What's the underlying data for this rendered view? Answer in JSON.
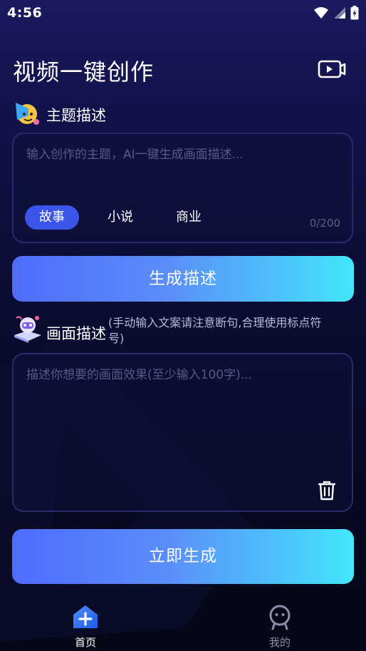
{
  "status": {
    "time": "4:56"
  },
  "header": {
    "title": "视频一键创作"
  },
  "theme_section": {
    "label": "主题描述",
    "placeholder": "输入创作的主题，AI一键生成画面描述...",
    "chips": [
      "故事",
      "小说",
      "商业"
    ],
    "active_chip": 0,
    "counter": "0/200"
  },
  "generate_desc_button": {
    "label": "生成描述"
  },
  "scene_section": {
    "label": "画面描述",
    "hint_line1": "(手动输入文案请注意断句,合理使用标点符",
    "hint_line2": "号)",
    "placeholder": "描述你想要的画面效果(至少输入100字)..."
  },
  "generate_now_button": {
    "label": "立即生成"
  },
  "tabbar": {
    "tabs": [
      {
        "label": "首页",
        "icon": "home-plus-icon",
        "active": true
      },
      {
        "label": "我的",
        "icon": "profile-icon",
        "active": false
      }
    ]
  },
  "colors": {
    "accent": "#3b55e8",
    "gradient_start": "#4f6cff",
    "gradient_end": "#43e6fb",
    "inactive_tab": "#8a8ea8"
  }
}
